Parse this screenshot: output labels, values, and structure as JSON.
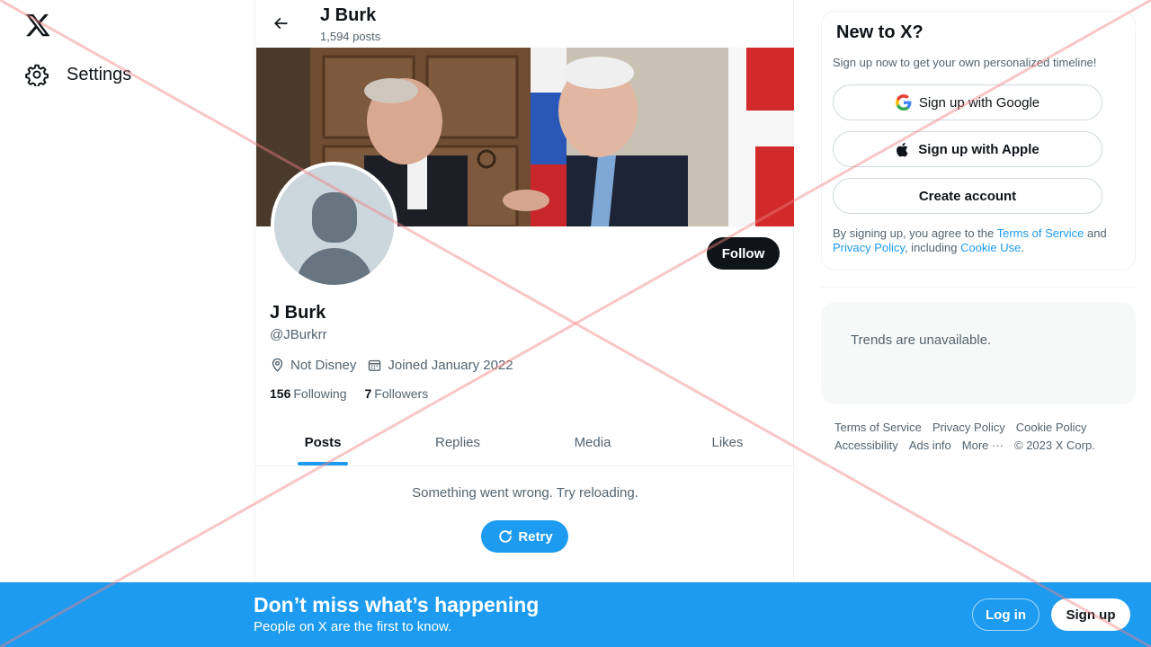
{
  "nav": {
    "logo_icon": "x-logo-icon",
    "settings_label": "Settings",
    "settings_icon": "gear-icon"
  },
  "header": {
    "name": "J Burk",
    "post_count": "1,594 posts",
    "back_icon": "arrow-left-icon"
  },
  "profile": {
    "name": "J Burk",
    "handle": "@JBurkrr",
    "location": "Not Disney",
    "joined": "Joined January 2022",
    "following_count": "156",
    "following_label": "Following",
    "followers_count": "7",
    "followers_label": "Followers",
    "follow_label": "Follow"
  },
  "tabs": [
    {
      "label": "Posts",
      "active": true
    },
    {
      "label": "Replies",
      "active": false
    },
    {
      "label": "Media",
      "active": false
    },
    {
      "label": "Likes",
      "active": false
    }
  ],
  "feed": {
    "error_text": "Something went wrong. Try reloading.",
    "retry_label": "Retry"
  },
  "signup": {
    "title": "New to X?",
    "subtitle": "Sign up now to get your own personalized timeline!",
    "google_label": "Sign up with Google",
    "apple_label": "Sign up with Apple",
    "create_label": "Create account",
    "legal_prefix": "By signing up, you agree to the ",
    "terms_link": "Terms of Service",
    "legal_and": " and ",
    "privacy_link": "Privacy Policy",
    "legal_including": ", including ",
    "cookie_link": "Cookie Use",
    "legal_end": "."
  },
  "trends": {
    "text": "Trends are unavailable."
  },
  "footer": {
    "terms": "Terms of Service",
    "privacy": "Privacy Policy",
    "cookie": "Cookie Policy",
    "accessibility": "Accessibility",
    "ads": "Ads info",
    "more": "More ···",
    "copyright": "© 2023 X Corp."
  },
  "bottom_bar": {
    "title": "Don’t miss what’s happening",
    "subtitle": "People on X are the first to know.",
    "login_label": "Log in",
    "signup_label": "Sign up"
  },
  "colors": {
    "accent": "#1d9bf0",
    "text_primary": "#0f1419",
    "text_secondary": "#536471",
    "overlay_x": "#f4a7a7"
  }
}
